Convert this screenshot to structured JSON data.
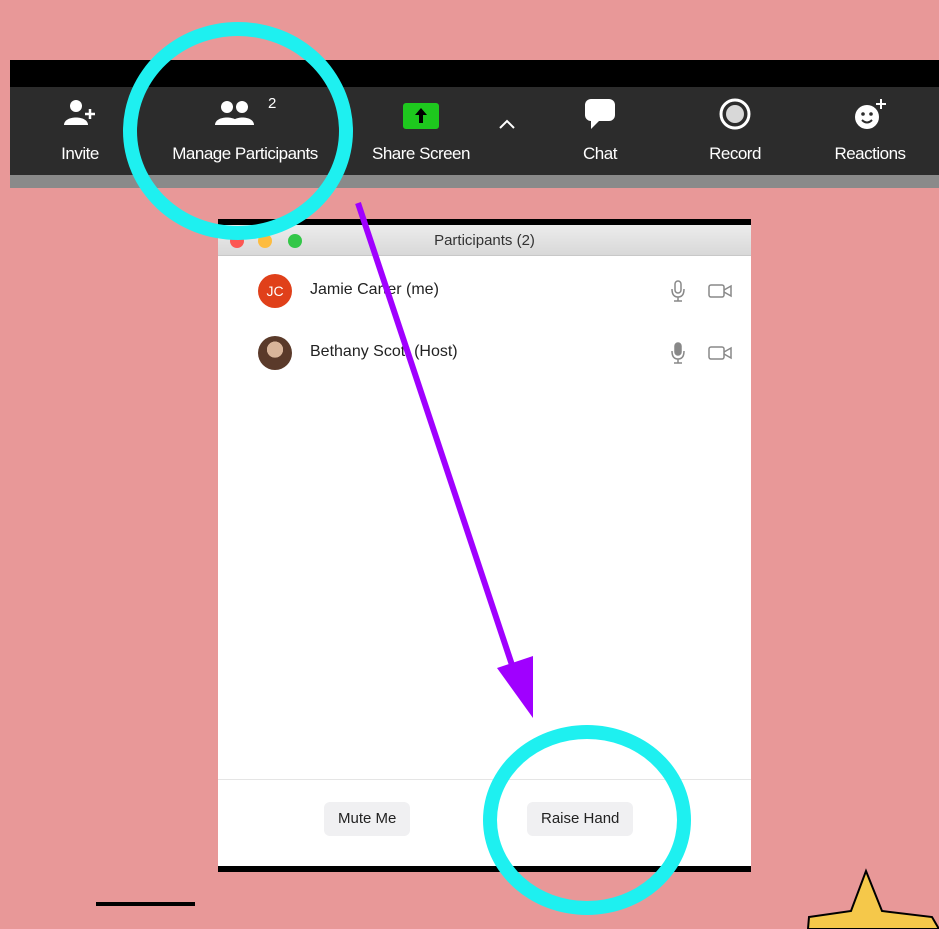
{
  "toolbar": {
    "items": [
      {
        "label": "Invite",
        "icon": "add-user-icon"
      },
      {
        "label": "Manage Participants",
        "icon": "participants-icon",
        "count": "2"
      },
      {
        "label": "Share Screen",
        "icon": "share-screen-icon"
      },
      {
        "label": "Chat",
        "icon": "chat-icon"
      },
      {
        "label": "Record",
        "icon": "record-icon"
      },
      {
        "label": "Reactions",
        "icon": "reactions-icon"
      }
    ]
  },
  "participants_window": {
    "title": "Participants (2)",
    "participants": [
      {
        "initials": "JC",
        "name": "Jamie Carter (me)",
        "avatar_color": "#e0401a"
      },
      {
        "initials": "",
        "name": "Bethany Scott (Host)",
        "avatar_color": "#6b4a3a"
      }
    ],
    "mute_button": "Mute Me",
    "raise_hand_button": "Raise Hand"
  },
  "colors": {
    "background": "#e89898",
    "highlight_circle": "#1ef0f0",
    "arrow": "#a000ff",
    "share_green": "#1ec81e",
    "star": "#f5c84a"
  }
}
